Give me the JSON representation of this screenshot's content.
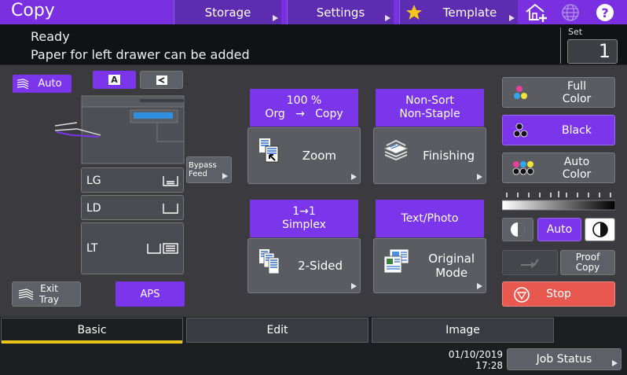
{
  "header": {
    "title": "Copy",
    "buttons": {
      "storage": "Storage",
      "settings": "Settings",
      "template": "Template"
    }
  },
  "status": {
    "line1": "Ready",
    "line2": "Paper for left drawer can be added",
    "set_label": "Set",
    "set_value": "1"
  },
  "machine": {
    "auto_label": "Auto",
    "orientation_a": "A",
    "bypass_label": "Bypass\nFeed",
    "drawers": [
      {
        "label": "LG"
      },
      {
        "label": "LD"
      },
      {
        "label": "LT"
      }
    ],
    "exit_tray": "Exit\nTray",
    "aps": "APS"
  },
  "functions": {
    "zoom_header_1": "100 %",
    "zoom_header_2": "Org   →   Copy",
    "zoom_label": "Zoom",
    "finishing_header": "Non-Sort\nNon-Staple",
    "finishing_label": "Finishing",
    "duplex_header": "1→1\nSimplex",
    "duplex_label": "2-Sided",
    "mode_header": "Text/Photo",
    "mode_label": "Original\nMode"
  },
  "color": {
    "full": "Full\nColor",
    "black": "Black",
    "auto": "Auto\nColor",
    "selected": "black",
    "density_auto": "Auto",
    "proof_copy": "Proof\nCopy",
    "stop": "Stop"
  },
  "tabs": [
    {
      "label": "Basic",
      "active": true
    },
    {
      "label": "Edit",
      "active": false
    },
    {
      "label": "Image",
      "active": false
    }
  ],
  "footer": {
    "date": "01/10/2019",
    "time": "17:28",
    "job_status": "Job Status"
  },
  "colors": {
    "accent": "#7b35ea",
    "stop": "#e8584f",
    "tab_indicator": "#e8c417"
  }
}
